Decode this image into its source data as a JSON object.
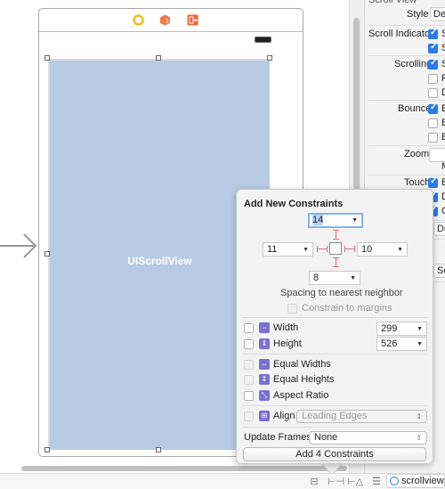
{
  "canvas": {
    "scroll_view_label": "UIScrollView",
    "scene_icons": [
      "view-controller-icon",
      "first-responder-icon",
      "exit-icon"
    ]
  },
  "inspector": {
    "section_title": "Scroll View",
    "style_label": "Style",
    "style_value": "De",
    "scroll_indicators_label": "Scroll Indicators",
    "scroll_indicators": [
      {
        "text": "S",
        "checked": true
      },
      {
        "text": "S",
        "checked": true
      }
    ],
    "scrolling_label": "Scrolling",
    "scrolling": [
      {
        "text": "S",
        "checked": true
      },
      {
        "text": "P",
        "checked": false
      },
      {
        "text": "D",
        "checked": false
      }
    ],
    "bounce_label": "Bounce",
    "bounce": [
      {
        "text": "B",
        "checked": true
      },
      {
        "text": "B",
        "checked": false
      },
      {
        "text": "B",
        "checked": false
      }
    ],
    "zoom_label": "Zoom",
    "zoom_sub": "M",
    "touch_label": "Touch",
    "touch": [
      {
        "text": "B",
        "checked": true
      },
      {
        "text": "D",
        "checked": true
      },
      {
        "text": "C",
        "checked": true
      }
    ],
    "keyboard_value": "Do",
    "indicator_value": "Sca"
  },
  "popover": {
    "title": "Add New Constraints",
    "top_value": "14",
    "left_value": "11",
    "right_value": "10",
    "bottom_value": "8",
    "spacing_label": "Spacing to nearest neighbor",
    "constrain_margins_label": "Constrain to margins",
    "width_label": "Width",
    "width_value": "299",
    "height_label": "Height",
    "height_value": "526",
    "equal_widths_label": "Equal Widths",
    "equal_heights_label": "Equal Heights",
    "aspect_ratio_label": "Aspect Ratio",
    "align_label": "Align",
    "align_value": "Leading Edges",
    "update_frames_label": "Update Frames",
    "update_frames_value": "None",
    "add_button_label": "Add 4 Constraints"
  },
  "bottom_bar": {
    "scene_name": "scrollview",
    "icons": [
      "stack-icon",
      "align-icon",
      "pin-icon",
      "resolve-icon",
      "outline-icon"
    ]
  },
  "colors": {
    "scroll_view_fill": "#b8cbe4",
    "strut_red": "#e96b6b",
    "checkbox_blue": "#2a7ae8",
    "focus_ring": "#84b3ee",
    "constraint_icon": "#7b6fd0"
  }
}
